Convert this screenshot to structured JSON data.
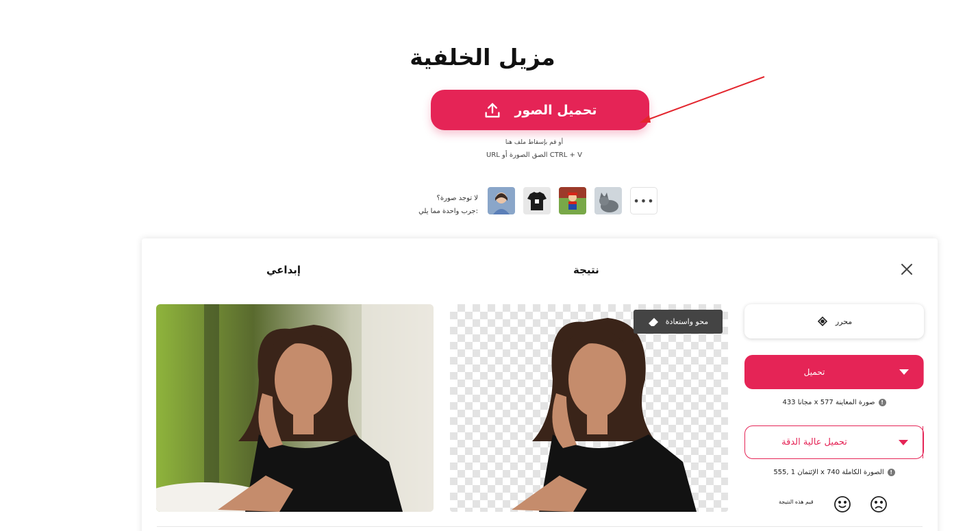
{
  "header": {
    "title": "مزيل الخلفية",
    "upload_label": "تحميل الصور",
    "drop_hint": "أو قم بإسقاط ملف هنا",
    "paste_hint": "URL الصق الصورة أو CTRL + V"
  },
  "samples": {
    "no_image_line1": "لا توجد صورة؟",
    "no_image_line2": "جرب واحدة مما يلي:",
    "more_label": "•••"
  },
  "result_panel": {
    "result_heading": "نتيجة",
    "original_heading": "إبداعي",
    "erase_restore_label": "محو واستعادة",
    "editor_label": "محرر",
    "download_label": "تحميل",
    "download_info": "مجانا 433 x صورة المعاينة 577",
    "hd_download_label": "تحميل عالية الدقة",
    "hd_info": "الإئتمان 1 ,555 x الصورة الكاملة 740",
    "rate_label": "قيم هذه النتيجة"
  },
  "colors": {
    "accent": "#e52456",
    "dark_chip": "#444444"
  }
}
